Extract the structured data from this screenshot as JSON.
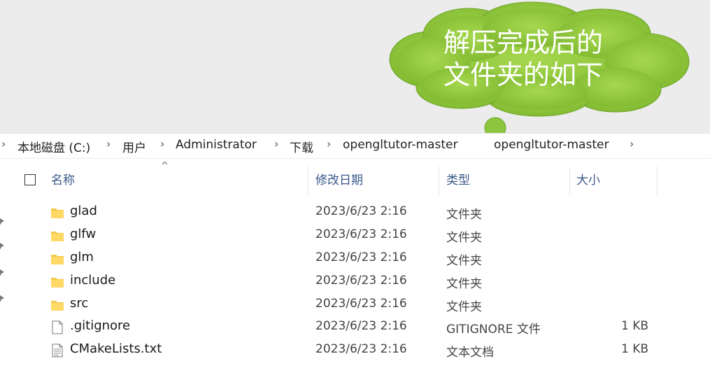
{
  "callout": {
    "line1": "解压完成后的",
    "line2": "文件夹的如下",
    "color": "#8cc63e"
  },
  "breadcrumb": {
    "items": [
      "本地磁盘 (C:)",
      "用户",
      "Administrator",
      "下载",
      "opengltutor-master",
      "opengltutor-master"
    ]
  },
  "columns": {
    "name": "名称",
    "date": "修改日期",
    "type": "类型",
    "size": "大小"
  },
  "files": [
    {
      "name": "glad",
      "date": "2023/6/23 2:16",
      "type": "文件夹",
      "size": "",
      "icon": "folder-icon"
    },
    {
      "name": "glfw",
      "date": "2023/6/23 2:16",
      "type": "文件夹",
      "size": "",
      "icon": "folder-icon"
    },
    {
      "name": "glm",
      "date": "2023/6/23 2:16",
      "type": "文件夹",
      "size": "",
      "icon": "folder-icon"
    },
    {
      "name": "include",
      "date": "2023/6/23 2:16",
      "type": "文件夹",
      "size": "",
      "icon": "folder-icon"
    },
    {
      "name": "src",
      "date": "2023/6/23 2:16",
      "type": "文件夹",
      "size": "",
      "icon": "folder-icon"
    },
    {
      "name": ".gitignore",
      "date": "2023/6/23 2:16",
      "type": "GITIGNORE 文件",
      "size": "1 KB",
      "icon": "file-icon"
    },
    {
      "name": "CMakeLists.txt",
      "date": "2023/6/23 2:16",
      "type": "文本文档",
      "size": "1 KB",
      "icon": "text-file-icon"
    }
  ]
}
